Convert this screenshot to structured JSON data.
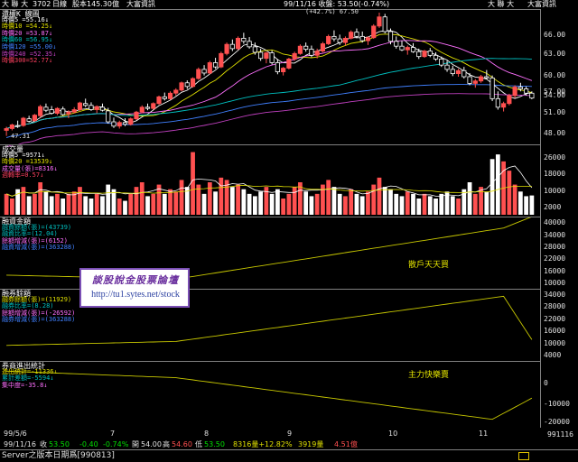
{
  "topbar": {
    "stock": "大 聯 大",
    "code": "3702",
    "period": "日線",
    "capital": "股本145.30億",
    "source": "大富資訊",
    "peak_change": "(+42.7%) 67.50",
    "quote": "99/11/16 收盤: 53.50(-0.74%)",
    "right_stock": "大 聯 大",
    "right_source": "大富資訊"
  },
  "price_panel": {
    "title": "還權K 線圖",
    "legend": [
      "時價5 =55.16↓",
      "時價10 =54.25↓",
      "時價20 =53.87↓",
      "時價60 =56.95↓",
      "時價120 =55.00↓",
      "時價240 =52.35↓",
      "時價300=52.77↓"
    ],
    "ticks": [
      "66.00",
      "63.00",
      "60.00",
      "57.00",
      "54.00",
      "51.00",
      "48.00"
    ],
    "low_label": "47.31"
  },
  "volume_panel": {
    "title": "成交量",
    "legend": [
      "時價5 =9571↓",
      "時價20 =13539↓",
      "成交量(張)=8316↓",
      "週轉率=0.57↓"
    ],
    "ticks": [
      "26000",
      "18000",
      "10000",
      "2000"
    ]
  },
  "margin_panel": {
    "title": "融資金額",
    "legend": [
      "融資餘額(張)=(43739)",
      "融資比率=(12.04)",
      "餘額增減(張)=(6152)",
      "融資增減(張)=(363288)"
    ],
    "ticks": [
      "40000",
      "34000",
      "28000",
      "22000",
      "16000",
      "10000"
    ],
    "annotation": "散戶天天買"
  },
  "short_panel": {
    "title": "融券餘額",
    "legend": [
      "融券餘額(張)=(11929)",
      "融券比率=(8.28)",
      "餘額增減(張)=(-26592)",
      "融券增減(張)=(363288)"
    ],
    "ticks": [
      "34000",
      "28000",
      "22000",
      "16000",
      "10000",
      "4000"
    ]
  },
  "broker_panel": {
    "title": "券商進出統計",
    "legend": [
      "進出統計=-11336↓",
      "累計差額=-5594↓",
      "集中度=-35.8↓"
    ],
    "ticks": [
      "0",
      "-10000",
      "-20000"
    ],
    "annotation": "主力快樂賣"
  },
  "watermark": {
    "title": "談股說金股票論壇",
    "url": "http://tu1.sytes.net/stock"
  },
  "dates": {
    "start": "99/5/6",
    "months": [
      "7",
      "8",
      "9",
      "10",
      "11"
    ],
    "end": "991116"
  },
  "statusbar": {
    "date": "99/11/16",
    "open_label": "收",
    "open": "53.50",
    "change": "-0.40",
    "pct": "-0.74%",
    "high_label": "開",
    "high": "54.00",
    "low_label": "高",
    "low": "54.60",
    "close_label": "低",
    "close": "53.50",
    "vol": "8316量+12.82%",
    "vol2": "3919量",
    "amt": "4.51億"
  },
  "footer": {
    "text": "Server之版本日期爲[990813]"
  },
  "colors": {
    "up": "#ff5050",
    "down": "#ffffff",
    "flat": "#00c000",
    "ma5": "#ffffff",
    "ma10": "#e0e000",
    "ma20": "#ff70ff",
    "ma60": "#00c0c0",
    "ma120": "#4080ff",
    "ma240": "#c040c0",
    "ma300": "#ff4060",
    "indicator": "#c8c800"
  },
  "chart_data": {
    "type": "candlestick",
    "y_range": [
      46.5,
      67.5
    ],
    "candles": [
      [
        48.2,
        48.8,
        47.3,
        48.5
      ],
      [
        48.5,
        49.3,
        48.2,
        49.1
      ],
      [
        49.0,
        49.8,
        48.6,
        48.9
      ],
      [
        49.0,
        50.4,
        48.8,
        50.2
      ],
      [
        50.1,
        50.6,
        49.5,
        49.7
      ],
      [
        49.8,
        50.9,
        49.6,
        50.7
      ],
      [
        50.6,
        52.4,
        50.3,
        52.1
      ],
      [
        52.0,
        52.6,
        51.2,
        51.5
      ],
      [
        51.6,
        52.2,
        50.8,
        51.0
      ],
      [
        51.0,
        52.0,
        50.7,
        51.8
      ],
      [
        51.7,
        52.1,
        50.6,
        50.8
      ],
      [
        50.9,
        51.5,
        50.2,
        51.2
      ],
      [
        51.2,
        52.0,
        51.0,
        51.6
      ],
      [
        51.6,
        52.9,
        51.4,
        52.7
      ],
      [
        52.6,
        53.4,
        52.0,
        52.3
      ],
      [
        52.3,
        52.8,
        51.4,
        51.6
      ],
      [
        51.6,
        52.3,
        51.0,
        52.1
      ],
      [
        52.0,
        52.6,
        51.3,
        51.5
      ],
      [
        51.4,
        51.9,
        49.3,
        49.6
      ],
      [
        49.6,
        50.3,
        48.6,
        48.9
      ],
      [
        48.9,
        49.8,
        48.5,
        49.5
      ],
      [
        49.5,
        50.2,
        48.9,
        49.2
      ],
      [
        49.2,
        50.3,
        49.0,
        50.1
      ],
      [
        50.1,
        51.4,
        49.9,
        51.2
      ],
      [
        51.2,
        52.3,
        51.0,
        52.0
      ],
      [
        52.0,
        52.6,
        51.5,
        51.8
      ],
      [
        51.8,
        52.8,
        51.6,
        52.6
      ],
      [
        52.6,
        53.9,
        52.4,
        53.7
      ],
      [
        53.7,
        54.4,
        53.1,
        53.4
      ],
      [
        53.4,
        54.6,
        53.2,
        54.3
      ],
      [
        54.3,
        55.1,
        53.9,
        54.8
      ],
      [
        54.8,
        56.2,
        54.6,
        56.0
      ],
      [
        56.0,
        56.4,
        55.0,
        55.4
      ],
      [
        55.4,
        56.9,
        55.2,
        56.7
      ],
      [
        56.7,
        58.5,
        56.5,
        58.2
      ],
      [
        58.2,
        58.9,
        57.2,
        57.6
      ],
      [
        57.6,
        59.6,
        57.4,
        59.3
      ],
      [
        59.3,
        60.1,
        58.3,
        58.6
      ],
      [
        58.6,
        61.1,
        58.4,
        60.8
      ],
      [
        60.8,
        62.6,
        60.5,
        62.3
      ],
      [
        62.3,
        63.1,
        61.2,
        61.6
      ],
      [
        61.6,
        63.6,
        61.4,
        63.3
      ],
      [
        63.3,
        64.2,
        62.4,
        62.8
      ],
      [
        62.8,
        63.5,
        61.6,
        61.9
      ],
      [
        61.9,
        62.6,
        60.6,
        61.0
      ],
      [
        61.0,
        61.6,
        59.6,
        60.0
      ],
      [
        60.0,
        61.1,
        59.2,
        60.9
      ],
      [
        60.9,
        61.3,
        59.0,
        59.3
      ],
      [
        59.3,
        59.9,
        57.4,
        57.8
      ],
      [
        57.8,
        58.6,
        57.2,
        58.4
      ],
      [
        58.4,
        60.1,
        58.2,
        59.9
      ],
      [
        59.9,
        61.1,
        59.6,
        60.8
      ],
      [
        60.8,
        62.3,
        60.6,
        62.0
      ],
      [
        62.0,
        62.6,
        61.1,
        61.5
      ],
      [
        61.5,
        62.1,
        60.2,
        60.5
      ],
      [
        60.5,
        61.6,
        60.0,
        61.2
      ],
      [
        61.2,
        62.7,
        61.0,
        62.4
      ],
      [
        62.4,
        63.9,
        62.2,
        63.6
      ],
      [
        63.6,
        64.6,
        62.8,
        63.2
      ],
      [
        63.2,
        63.9,
        62.2,
        62.6
      ],
      [
        62.6,
        63.6,
        62.1,
        63.3
      ],
      [
        63.3,
        64.6,
        63.1,
        64.3
      ],
      [
        64.3,
        64.9,
        63.3,
        63.6
      ],
      [
        63.6,
        64.4,
        62.6,
        62.9
      ],
      [
        62.9,
        63.6,
        62.2,
        63.4
      ],
      [
        63.4,
        65.6,
        63.2,
        65.3
      ],
      [
        65.3,
        67.5,
        65.0,
        66.8
      ],
      [
        66.8,
        67.3,
        64.1,
        64.4
      ],
      [
        64.4,
        64.9,
        62.3,
        62.8
      ],
      [
        62.8,
        63.6,
        61.6,
        62.0
      ],
      [
        62.0,
        62.9,
        61.2,
        61.4
      ],
      [
        61.4,
        62.1,
        60.6,
        61.8
      ],
      [
        61.8,
        62.5,
        60.9,
        61.1
      ],
      [
        61.1,
        61.6,
        59.9,
        60.3
      ],
      [
        60.3,
        61.4,
        60.1,
        61.2
      ],
      [
        61.2,
        61.7,
        60.2,
        60.5
      ],
      [
        60.5,
        61.0,
        59.6,
        59.9
      ],
      [
        59.9,
        60.3,
        58.6,
        58.9
      ],
      [
        58.9,
        59.6,
        57.8,
        58.2
      ],
      [
        58.2,
        58.8,
        57.1,
        57.5
      ],
      [
        57.5,
        58.3,
        57.0,
        58.0
      ],
      [
        58.0,
        58.6,
        56.7,
        57.0
      ],
      [
        57.0,
        57.6,
        55.6,
        55.9
      ],
      [
        55.9,
        56.6,
        55.2,
        56.3
      ],
      [
        56.3,
        57.3,
        56.0,
        57.0
      ],
      [
        57.0,
        58.1,
        56.6,
        56.8
      ],
      [
        56.8,
        57.2,
        53.0,
        53.4
      ],
      [
        53.4,
        54.6,
        51.6,
        52.0
      ],
      [
        52.0,
        52.9,
        51.3,
        52.6
      ],
      [
        52.6,
        54.2,
        52.3,
        53.9
      ],
      [
        53.9,
        55.6,
        53.5,
        55.3
      ],
      [
        55.3,
        56.0,
        54.6,
        55.0
      ],
      [
        55.0,
        55.4,
        53.9,
        54.3
      ],
      [
        54.3,
        54.6,
        53.3,
        53.5
      ]
    ],
    "volume": [
      9000,
      7000,
      11000,
      12000,
      8000,
      9000,
      14000,
      10000,
      8000,
      9000,
      7000,
      9000,
      10000,
      12000,
      8000,
      7000,
      9000,
      8000,
      13000,
      11000,
      7000,
      6000,
      9000,
      12000,
      14000,
      8000,
      9000,
      13000,
      9000,
      11000,
      10000,
      15000,
      12000,
      27000,
      13000,
      9000,
      14000,
      10000,
      16000,
      15000,
      12000,
      13000,
      11000,
      9000,
      8000,
      10000,
      12000,
      9000,
      11000,
      7000,
      9000,
      12000,
      14000,
      10000,
      8000,
      9000,
      13000,
      15000,
      12000,
      9000,
      8000,
      11000,
      9000,
      8000,
      10000,
      13000,
      16000,
      12000,
      11000,
      9000,
      8000,
      10000,
      9000,
      7000,
      9000,
      8000,
      7000,
      9000,
      10000,
      8000,
      7000,
      11000,
      14000,
      9000,
      12000,
      10000,
      24000,
      26000,
      23000,
      19000,
      13000,
      10000,
      8000,
      8316
    ],
    "margin_balance": [
      14000,
      12000,
      38000,
      43739
    ],
    "short_balance": [
      9000,
      11000,
      34000,
      11929
    ],
    "broker_net": [
      1000,
      -2000,
      -21000,
      -11336
    ]
  }
}
